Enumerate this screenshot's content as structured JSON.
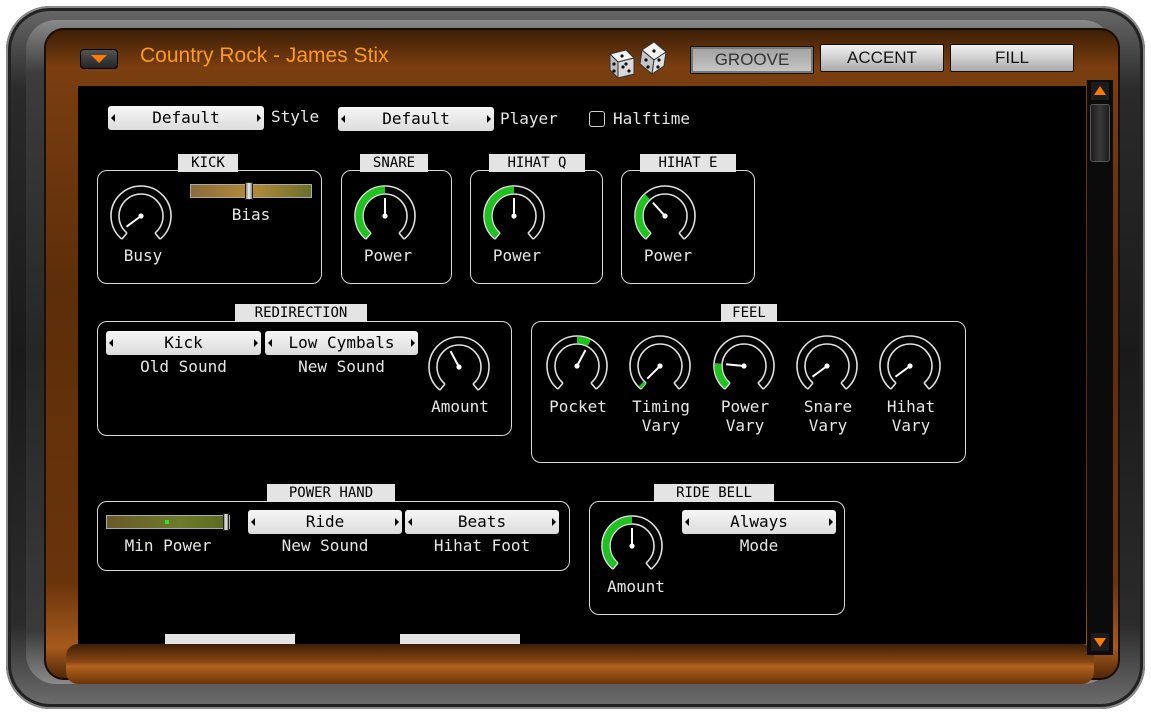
{
  "header": {
    "title": "Country Rock - James Stix",
    "buttons": [
      {
        "label": "GROOVE",
        "active": true
      },
      {
        "label": "ACCENT",
        "active": false
      },
      {
        "label": "FILL",
        "active": false
      }
    ]
  },
  "top_row": {
    "style_value": "Default",
    "style_label": "Style",
    "player_value": "Default",
    "player_label": "Player",
    "halftime_label": "Halftime",
    "halftime_checked": false
  },
  "kick": {
    "title": "KICK",
    "busy_label": "Busy",
    "bias_label": "Bias",
    "bias_value": 0.5
  },
  "snare": {
    "title": "SNARE",
    "power_label": "Power",
    "power_value": 0.5
  },
  "hihat_q": {
    "title": "HIHAT Q",
    "power_label": "Power",
    "power_value": 0.5
  },
  "hihat_e": {
    "title": "HIHAT E",
    "power_label": "Power",
    "power_value": 0.35
  },
  "redirection": {
    "title": "REDIRECTION",
    "old_sound_value": "Kick",
    "old_sound_label": "Old Sound",
    "new_sound_value": "Low Cymbals",
    "new_sound_label": "New Sound",
    "amount_label": "Amount"
  },
  "feel": {
    "title": "FEEL",
    "pocket_label": "Pocket",
    "timing_label_1": "Timing",
    "timing_label_2": "Vary",
    "power_label_1": "Power",
    "power_label_2": "Vary",
    "snare_label_1": "Snare",
    "snare_label_2": "Vary",
    "hihat_label_1": "Hihat",
    "hihat_label_2": "Vary"
  },
  "power_hand": {
    "title": "POWER HAND",
    "min_power_label": "Min Power",
    "min_power_value": 0.95,
    "new_sound_value": "Ride",
    "new_sound_label": "New Sound",
    "hihat_foot_value": "Beats",
    "hihat_foot_label": "Hihat Foot"
  },
  "ride_bell": {
    "title": "RIDE BELL",
    "amount_label": "Amount",
    "amount_value": 0.5,
    "mode_value": "Always",
    "mode_label": "Mode"
  },
  "colors": {
    "accent_orange": "#ff9a1a",
    "knob_green": "#1fc21f",
    "panel_bg": "#000000"
  }
}
